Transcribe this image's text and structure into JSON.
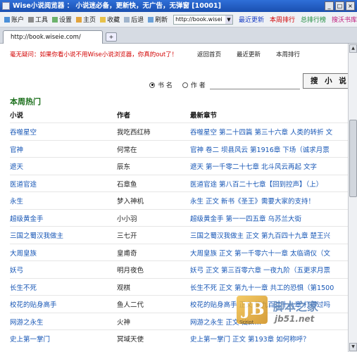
{
  "window": {
    "title": "Wise小说阅览器 ： 小说迷必备，更新快，无广告，无弹窗 [10001]"
  },
  "toolbar": {
    "items": [
      "账户",
      "工具",
      "设置",
      "主页",
      "收藏",
      "后退",
      "刷新"
    ],
    "address": "http://book.wisei",
    "links": [
      "最近更新",
      "本周排行",
      "总排行榜",
      "搜沃书库"
    ]
  },
  "tab": {
    "label": "http://book.wiseie.com/"
  },
  "page": {
    "banner": "毫无疑问：如果你看小说不用Wise小说浏览器，你真的out了！",
    "topnav": [
      "返回首页",
      "最近更新",
      "本周排行"
    ],
    "search": {
      "opt1": "书 名",
      "opt2": "作 者",
      "button": "搜 小 说"
    },
    "section_title": "本周热门",
    "columns": [
      "小说",
      "作者",
      "最新章节"
    ],
    "rows": [
      [
        "吞噬星空",
        "我吃西红柿",
        "吞噬星空 第二十四篇 第三十六章 人类的转折 文"
      ],
      [
        "官神",
        "何常在",
        "官神 卷二 坝县风云 第1916章 下场（诚求月票"
      ],
      [
        "遮天",
        "辰东",
        "遮天 第一千零二十七章 北斗风云再起 文字"
      ],
      [
        "医道官途",
        "石章鱼",
        "医道官途 第八百二十七章【回到控声】（上）"
      ],
      [
        "永生",
        "梦入神机",
        "永生 正文 新书《圣王》需要大家的支持！"
      ],
      [
        "超级黄金手",
        "小小羽",
        "超级黄金手 第一一四五章 乌苏兰大街"
      ],
      [
        "三国之蜀汉我做主",
        "三七开",
        "三国之蜀汉我做主 正文 第九百四十九章 楚王兴"
      ],
      [
        "大周皇族",
        "皇甫奇",
        "大周皇族 正文 第一千零六十一章 太临谪仪（文"
      ],
      [
        "妖弓",
        "明月夜色",
        "妖弓 正文 第三百零六章 一夜九阶（五更求月票"
      ],
      [
        "长生不死",
        "观棋",
        "长生不死 正文 第九十一章 共工的恐惧（第1500"
      ],
      [
        "校花的贴身高手",
        "鱼人二代",
        "校花的贴身高手 正文 第九百二十八章 打得过吗"
      ],
      [
        "网游之永生",
        "火神",
        "网游之永生 正文 仙……"
      ],
      [
        "史上第一掌门",
        "冥域天使",
        "史上第一掌门 正文 第193章 如何称呼？"
      ]
    ]
  },
  "watermark": {
    "logo_letter": "JB",
    "site_name": "脚本之家",
    "domain": "jb51.net",
    "script_label": "Script"
  },
  "colors": {
    "link": "#1555b5",
    "section": "#1a6e1a",
    "banner": "#d20000",
    "title_bar": "#1a4fb0"
  }
}
